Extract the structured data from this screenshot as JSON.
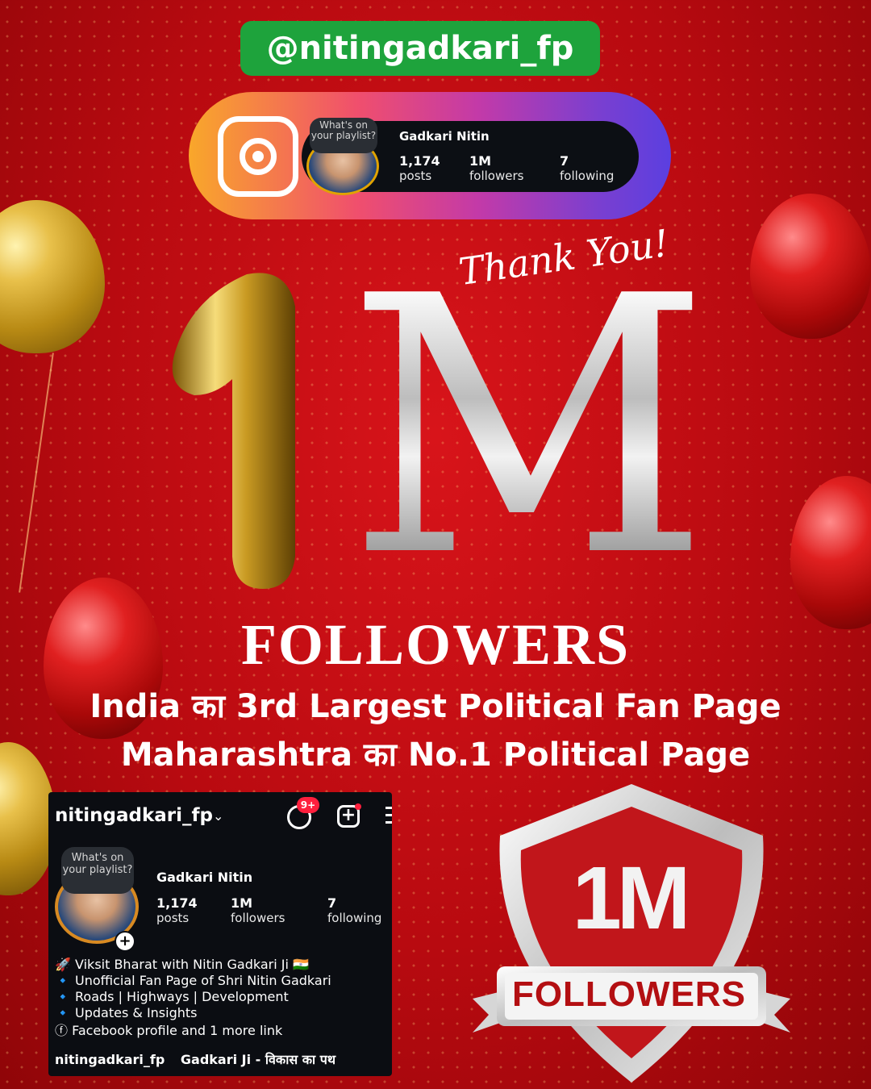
{
  "handle": "@nitingadkari_fp",
  "top_card": {
    "bubble": "What's on your playlist?",
    "name": "Gadkari Nitin",
    "stats": [
      {
        "num": "1,174",
        "label": "posts"
      },
      {
        "num": "1M",
        "label": "followers"
      },
      {
        "num": "7",
        "label": "following"
      }
    ]
  },
  "thanks": "Thank You!",
  "headline": {
    "one": "1",
    "m": "M",
    "followers": "FOLLOWERS",
    "line1": "India का 3rd Largest Political Fan Page",
    "line2": "Maharashtra का No.1 Political Page"
  },
  "profile": {
    "username": "nitingadkari_fp",
    "caret": "⌄",
    "notif_badge": "9+",
    "add_icon": "+",
    "bubble": "What's on your playlist?",
    "name": "Gadkari Nitin",
    "plus": "+",
    "stats": [
      {
        "num": "1,174",
        "label": "posts"
      },
      {
        "num": "1M",
        "label": "followers"
      },
      {
        "num": "7",
        "label": "following"
      }
    ],
    "bio": [
      "🚀 Viksit Bharat with Nitin Gadkari Ji 🇮🇳",
      "🔹 Unofficial Fan Page of Shri Nitin Gadkari",
      "🔹 Roads | Highways | Development",
      "🔹 Updates & Insights",
      "ⓕ Facebook profile and 1 more link"
    ],
    "threads_handle": "nitingadkari_fp",
    "threads_name": "Gadkari Ji - विकास का पथ"
  },
  "shield": {
    "big": "1M",
    "ribbon": "FOLLOWERS"
  },
  "colors": {
    "background": "#c20c12",
    "handle_badge": "#1ea33c",
    "gold": "#d9a82a",
    "silver": "#e6e6e6",
    "profile_bg": "#0b0d12"
  }
}
